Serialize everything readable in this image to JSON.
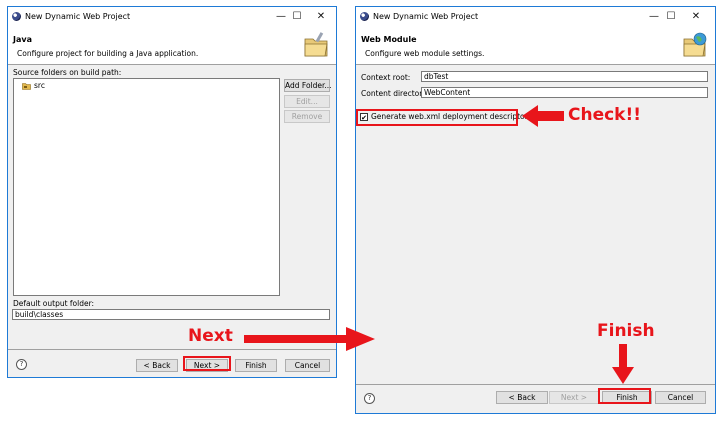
{
  "left_window": {
    "title": "New Dynamic Web Project",
    "banner_title": "Java",
    "banner_description": "Configure project for building a Java application.",
    "source_folders_label": "Source folders on build path:",
    "tree_items": [
      {
        "icon": "source-folder-icon",
        "label": "src"
      }
    ],
    "side_buttons": {
      "add_folder": "Add Folder...",
      "edit": "Edit...",
      "remove": "Remove"
    },
    "output_folder_label": "Default output folder:",
    "output_folder_value": "build\\classes",
    "footer": {
      "back": "< Back",
      "next": "Next >",
      "finish": "Finish",
      "cancel": "Cancel"
    }
  },
  "right_window": {
    "title": "New Dynamic Web Project",
    "banner_title": "Web Module",
    "banner_description": "Configure web module settings.",
    "context_root_label": "Context root:",
    "context_root_value": "dbTest",
    "content_directory_label": "Content directory:",
    "content_directory_value": "WebContent",
    "generate_descriptor_label": "Generate web.xml deployment descriptor",
    "generate_descriptor_checked": true,
    "footer": {
      "back": "< Back",
      "next": "Next >",
      "finish": "Finish",
      "cancel": "Cancel"
    }
  },
  "annotations": {
    "next": "Next",
    "check": "Check!!",
    "finish": "Finish",
    "color": "#e8151b"
  },
  "window_controls": {
    "minimize": "—",
    "maximize": "☐",
    "close": "✕"
  },
  "help_glyph": "?"
}
